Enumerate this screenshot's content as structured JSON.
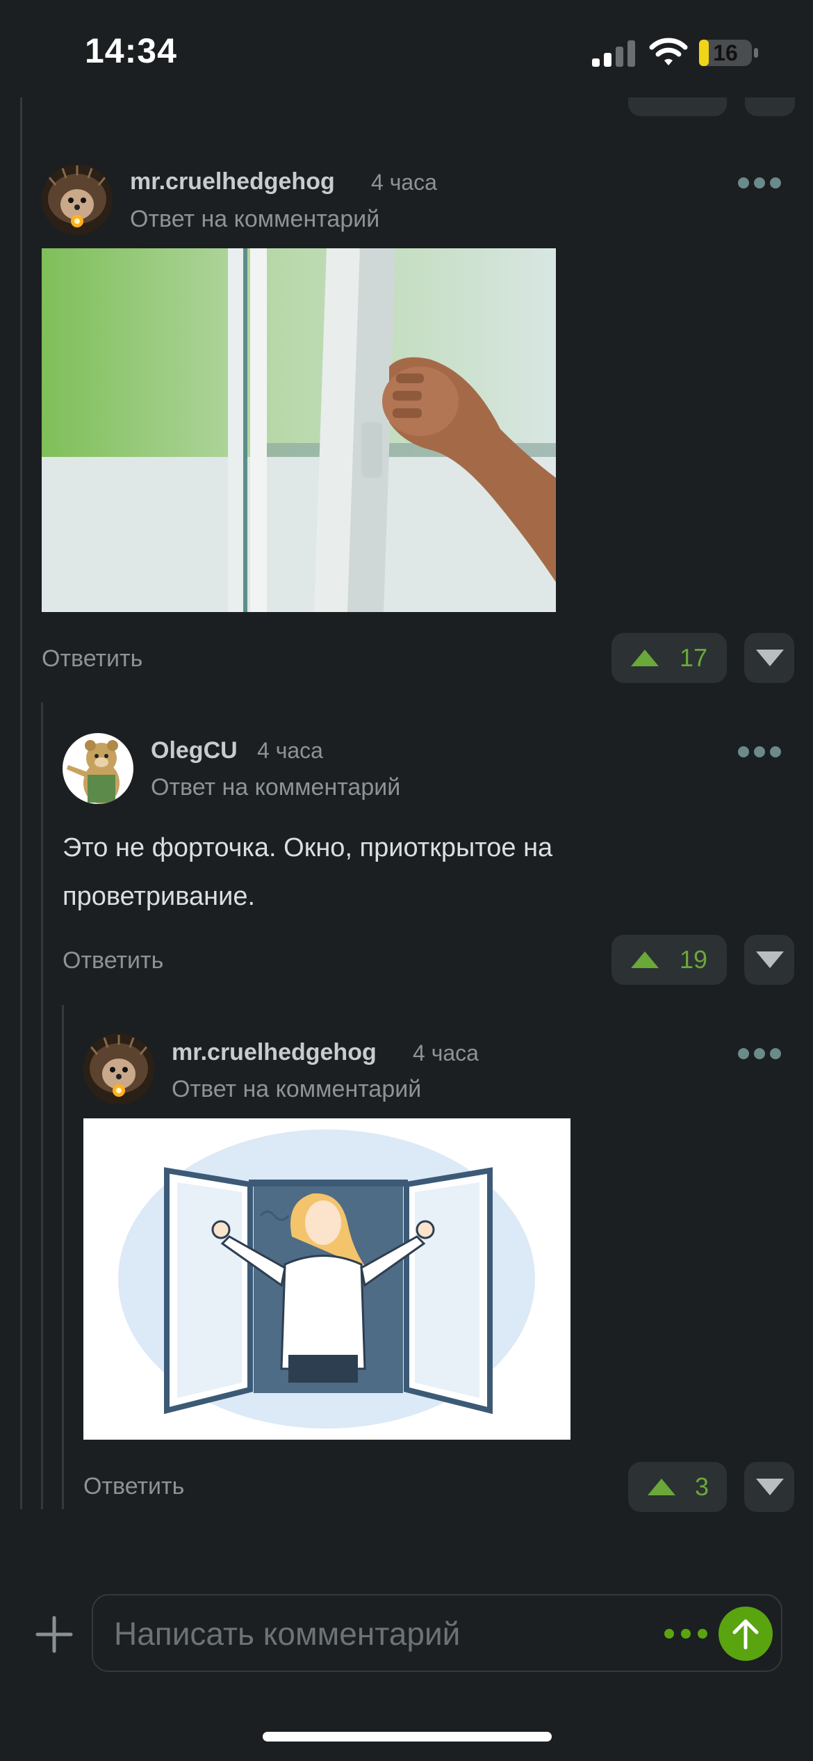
{
  "status_bar": {
    "time": "14:34",
    "battery_percent": "16"
  },
  "comments": [
    {
      "username": "mr.cruelhedgehog",
      "time_ago": "4 часа",
      "reply_to": "Ответ на комментарий",
      "reply_label": "Ответить",
      "upvotes": "17",
      "attachment_icon": "photo-hand-opening-window"
    },
    {
      "username": "OlegCU",
      "time_ago": "4 часа",
      "reply_to": "Ответ на комментарий",
      "text_line1": "Это не форточка. Окно, приоткрытое на",
      "text_line2": "проветривание.",
      "reply_label": "Ответить",
      "upvotes": "19"
    },
    {
      "username": "mr.cruelhedgehog",
      "time_ago": "4 часа",
      "reply_to": "Ответ на комментарий",
      "reply_label": "Ответить",
      "upvotes": "3",
      "attachment_icon": "illustration-woman-opening-window"
    }
  ],
  "composer": {
    "placeholder": "Написать комментарий"
  },
  "colors": {
    "background": "#1b1f21",
    "button_bg": "#2c3133",
    "vote_green": "#6aa83a",
    "send_green": "#5aa410",
    "muted_text": "#8d9396"
  }
}
